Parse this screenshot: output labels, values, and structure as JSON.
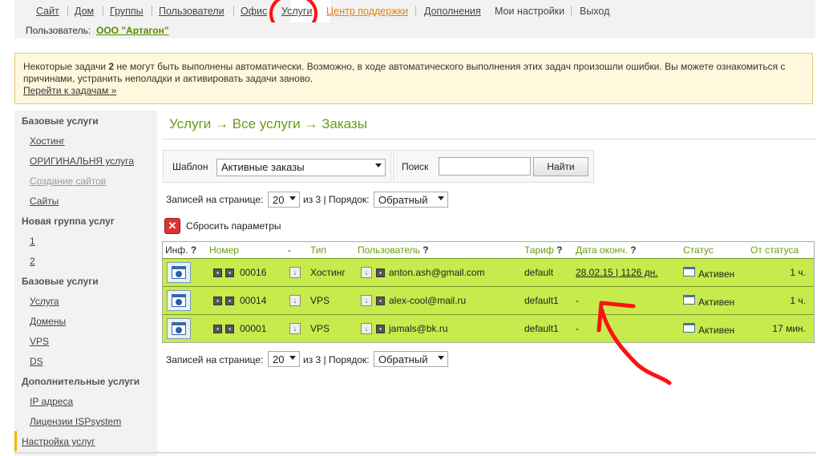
{
  "nav": {
    "items": [
      "Сайт",
      "Дом",
      "Группы",
      "Пользователи",
      "Офис",
      "Услуги",
      "Центр поддержки",
      "Дополнения",
      "Мои настройки",
      "Выход"
    ]
  },
  "user": {
    "label": "Пользователь:",
    "name": "ООО \"Артагон\""
  },
  "alert": {
    "text_before": "Некоторые задачи ",
    "count": "2",
    "text_after": " не могут быть выполнены автоматически. Возможно, в ходе автоматического выполнения этих задач произошли ошибки. Вы можете ознакомиться с причинами, устранить неполадки и активировать задачи заново.",
    "link": "Перейти к задачам »"
  },
  "sidebar": [
    {
      "type": "group",
      "label": "Базовые услуги"
    },
    {
      "type": "item",
      "label": "Хостинг"
    },
    {
      "type": "item",
      "label": "ОРИГИНАЛЬНЯ услуга"
    },
    {
      "type": "item",
      "label": "Создание сайтов",
      "disabled": true
    },
    {
      "type": "item",
      "label": "Сайты"
    },
    {
      "type": "group",
      "label": "Новая группа услуг"
    },
    {
      "type": "item",
      "label": "1"
    },
    {
      "type": "item",
      "label": "2"
    },
    {
      "type": "group",
      "label": "Базовые услуги"
    },
    {
      "type": "item",
      "label": "Услуга"
    },
    {
      "type": "item",
      "label": "Домены"
    },
    {
      "type": "item",
      "label": "VPS"
    },
    {
      "type": "item",
      "label": "DS"
    },
    {
      "type": "group",
      "label": "Дополнительные услуги"
    },
    {
      "type": "item",
      "label": "IP адреса"
    },
    {
      "type": "item",
      "label": "Лицензии ISPsystem"
    },
    {
      "type": "item",
      "label": "Настройка услуг",
      "active": true
    }
  ],
  "breadcrumb": "Услуги → Все услуги → Заказы",
  "filter": {
    "template_label": "Шаблон",
    "template_value": "Активные заказы",
    "search_label": "Поиск",
    "search_value": "",
    "find_button": "Найти"
  },
  "pager": {
    "per_page_label": "Записей на странице:",
    "per_page": "20",
    "of_pages": "из 3 | Порядок:",
    "order": "Обратный"
  },
  "reset_label": "Сбросить параметры",
  "table": {
    "headers": {
      "info": "Инф.",
      "number": "Номер",
      "dash": "-",
      "type": "Тип",
      "user": "Пользователь",
      "tariff": "Тариф",
      "end_date": "Дата оконч.",
      "status": "Статус",
      "since_status": "От статуса",
      "qmark": "?"
    },
    "rows": [
      {
        "number": "00016",
        "type": "Хостинг",
        "user": "anton.ash@gmail.com",
        "tariff": "default",
        "end_date": "28.02.15 | 1126 дн.",
        "status": "Активен",
        "since": "1 ч."
      },
      {
        "number": "00014",
        "type": "VPS",
        "user": "alex-cool@mail.ru",
        "tariff": "default1",
        "end_date": "-",
        "status": "Активен",
        "since": "1 ч."
      },
      {
        "number": "00001",
        "type": "VPS",
        "user": "jamals@bk.ru",
        "tariff": "default1",
        "end_date": "-",
        "status": "Активен",
        "since": "17 мин."
      }
    ]
  },
  "icons": {
    "info": "window-info-icon",
    "flag": "flag-icon",
    "arrow": "down-arrow-icon",
    "status": "status-window-icon",
    "reset": "reset-x-icon"
  },
  "colors": {
    "accent_green": "#6b9a10",
    "row_green": "#c7eb4c",
    "annotation_red": "#ff1111",
    "support_orange": "#e8820c"
  }
}
